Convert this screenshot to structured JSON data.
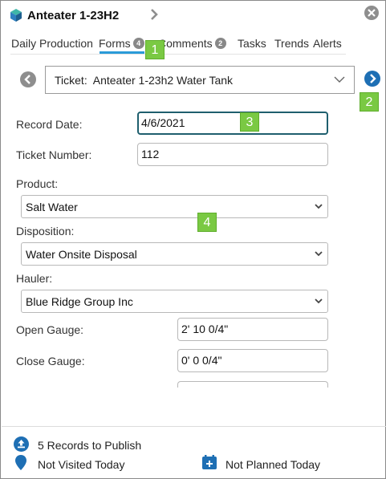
{
  "header": {
    "title": "Anteater 1-23H2",
    "logo_icon": "cube-logo-icon",
    "chevron_icon": "chevron-right-icon",
    "close_icon": "close-icon"
  },
  "tabs": [
    {
      "label": "Daily Production",
      "badge": ""
    },
    {
      "label": "Forms",
      "badge": "4",
      "active": true
    },
    {
      "label": "Comments",
      "badge": "2"
    },
    {
      "label": "Tasks",
      "badge": ""
    },
    {
      "label": "Trends",
      "badge": ""
    },
    {
      "label": "Alerts",
      "badge": ""
    }
  ],
  "callouts": [
    "1",
    "2",
    "3",
    "4"
  ],
  "ticket": {
    "label": "Ticket:",
    "value": "Anteater 1-23h2 Water Tank",
    "prev_icon": "chevron-left-circle-icon",
    "next_icon": "chevron-right-circle-icon"
  },
  "form": {
    "record_date": {
      "label": "Record Date:",
      "value": "4/6/2021"
    },
    "ticket_number": {
      "label": "Ticket Number:",
      "value": "112"
    },
    "product": {
      "label": "Product:",
      "value": "Salt Water"
    },
    "disposition": {
      "label": "Disposition:",
      "value": "Water Onsite Disposal"
    },
    "hauler": {
      "label": "Hauler:",
      "value": "Blue Ridge Group Inc"
    },
    "open_gauge": {
      "label": "Open Gauge:",
      "value": "2' 10 0/4\""
    },
    "close_gauge": {
      "label": "Close Gauge:",
      "value": "0' 0 0/4\""
    }
  },
  "footer": {
    "records": "5 Records to Publish",
    "visited": "Not Visited Today",
    "planned": "Not Planned Today",
    "upload_icon": "upload-icon",
    "location_icon": "map-pin-icon",
    "calendar_icon": "calendar-plus-icon"
  },
  "colors": {
    "accent": "#2a9bd8",
    "callout": "#7ac943",
    "nav_next": "#1e6fb4",
    "nav_prev": "#8e8e8e",
    "active_border": "#1f5f6e",
    "footer_icon": "#1e6fb4"
  }
}
